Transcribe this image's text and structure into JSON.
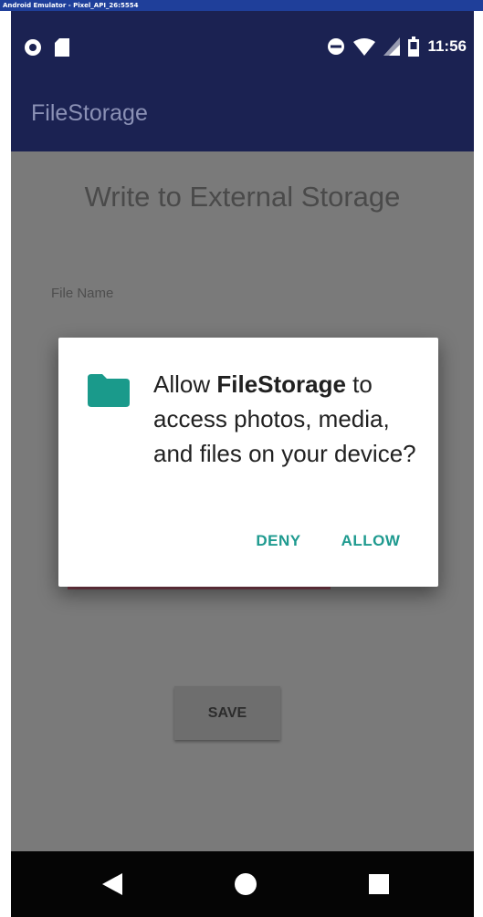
{
  "window": {
    "title": "Android Emulator - Pixel_API_26:5554"
  },
  "status_bar": {
    "time": "11:56"
  },
  "app_bar": {
    "title": "FileStorage"
  },
  "content": {
    "title": "Write to External Storage",
    "file_name_label": "File Name",
    "save_label": "SAVE"
  },
  "dialog": {
    "message_prefix": "Allow ",
    "app_name": "FileStorage",
    "message_suffix": " to access photos, media, and files on your device?",
    "deny_label": "DENY",
    "allow_label": "ALLOW",
    "accent_color": "#1e9a8f",
    "icon": "folder-icon"
  },
  "colors": {
    "app_bar": "#1b2252",
    "scrim": "#7a7a7a",
    "nav_bar": "#050505"
  }
}
